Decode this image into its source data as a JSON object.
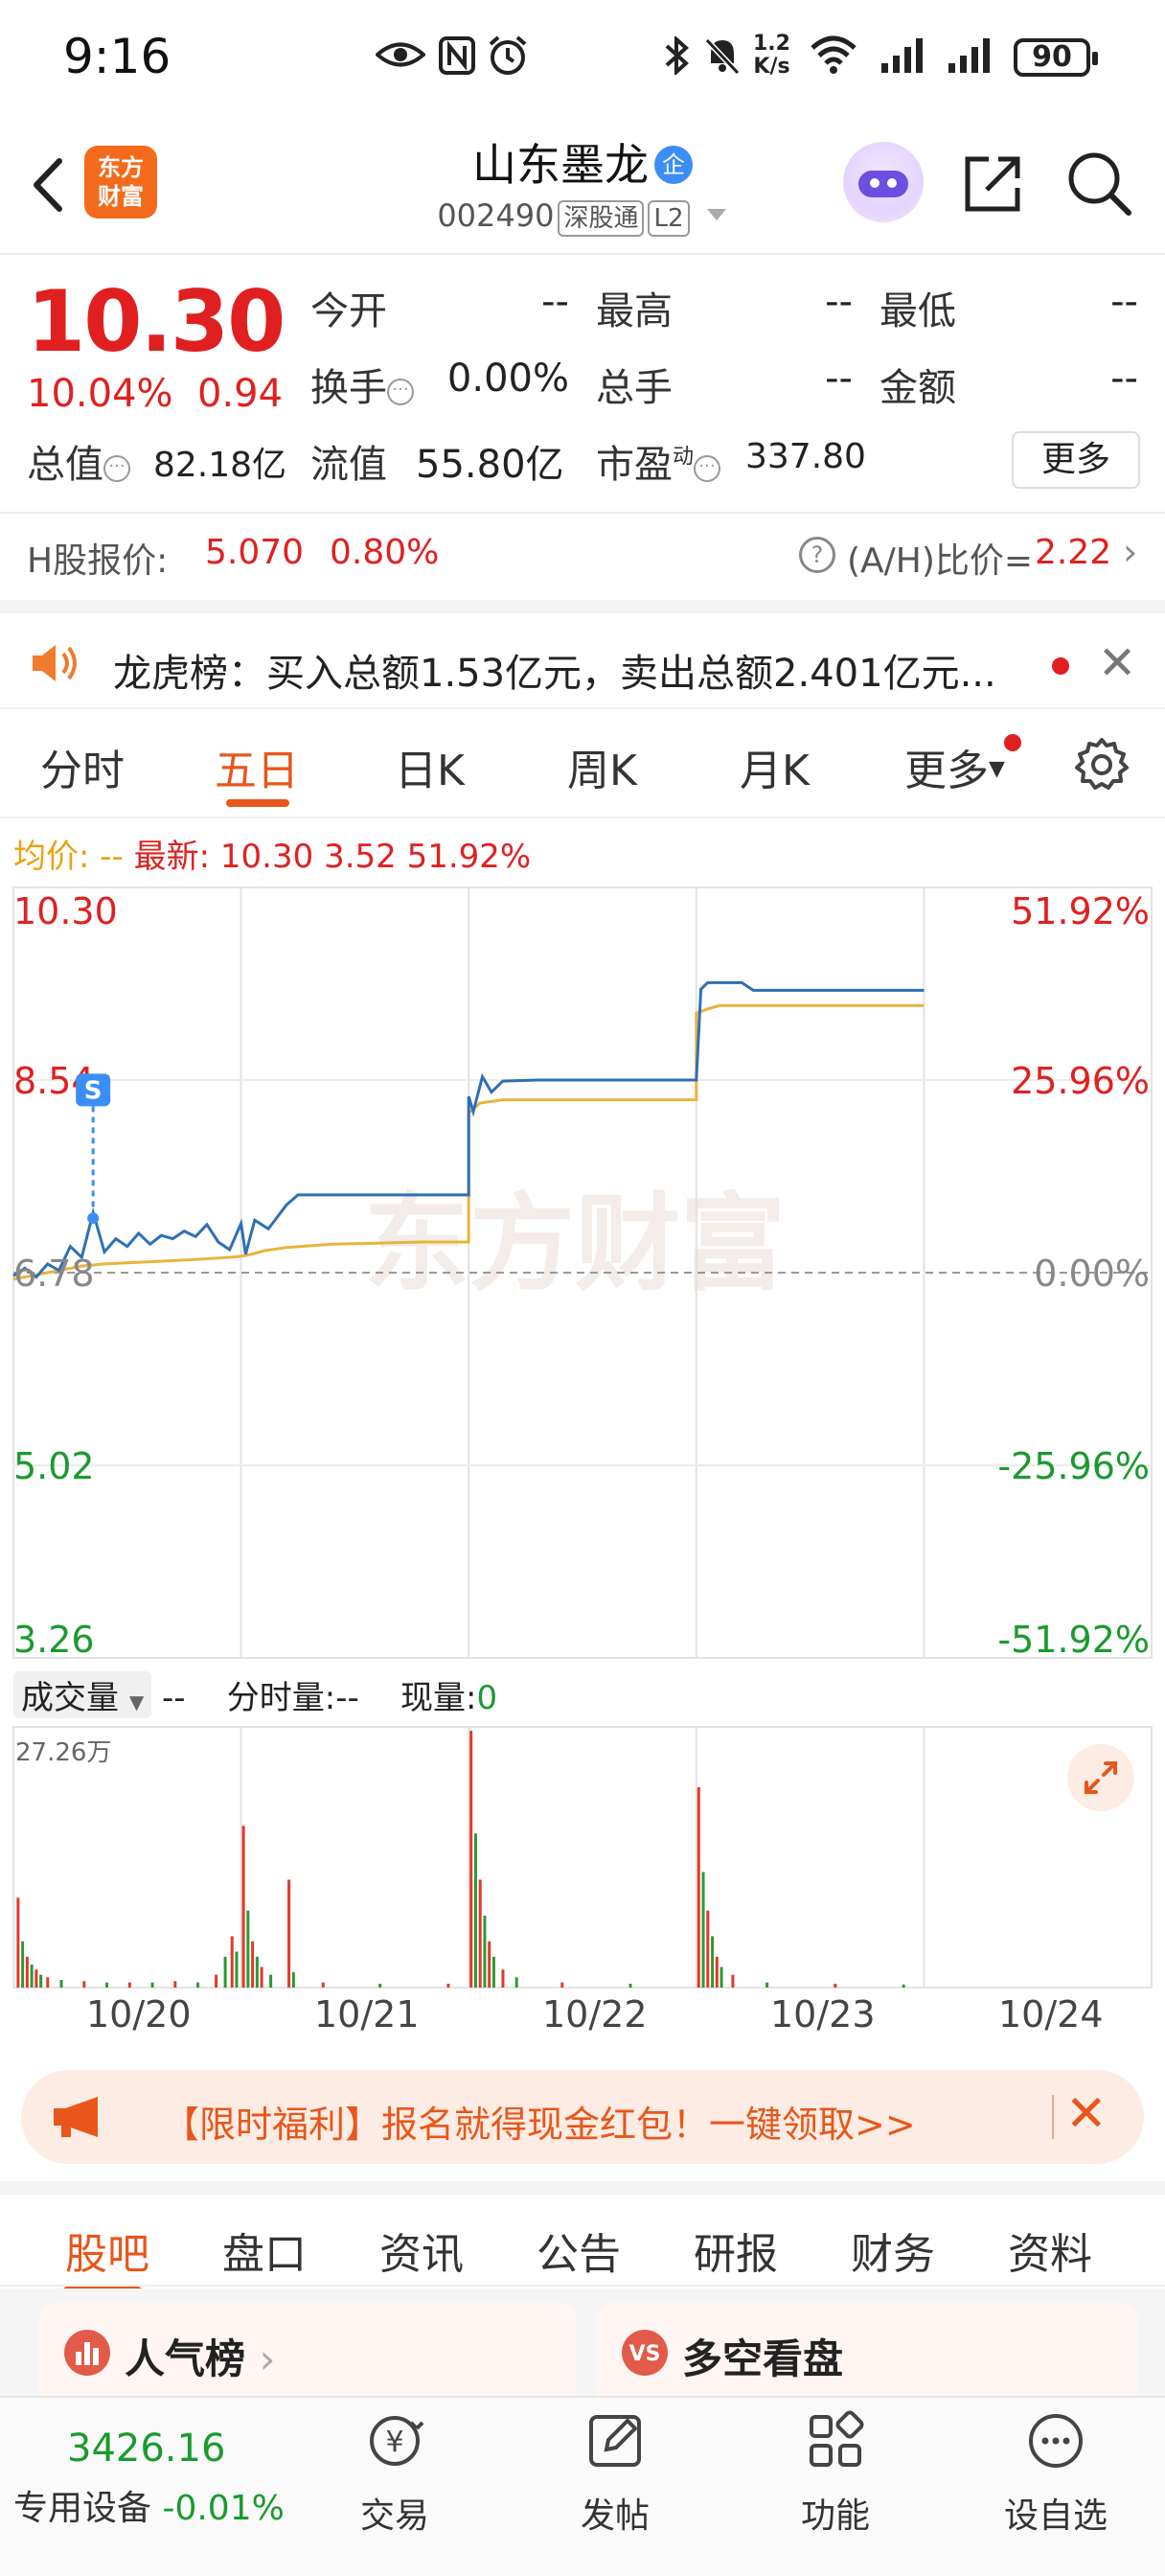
{
  "status_bar": {
    "time": "9:16",
    "net_speed": "1.2\nK/s",
    "battery": "90"
  },
  "header": {
    "app_logo_line1": "东方",
    "app_logo_line2": "财富",
    "stock_name": "山东墨龙",
    "name_badge": "企",
    "stock_code": "002490",
    "tag_connect": "深股通",
    "tag_level": "L2"
  },
  "quote": {
    "price": "10.30",
    "change_pct": "10.04%",
    "change_amt": "0.94",
    "open_label": "今开",
    "open_val": "--",
    "high_label": "最高",
    "high_val": "--",
    "low_label": "最低",
    "low_val": "--",
    "turnover_label": "换手",
    "turnover_val": "0.00%",
    "volume_label": "总手",
    "volume_val": "--",
    "amount_label": "金额",
    "amount_val": "--",
    "mktcap_label": "总值",
    "mktcap_val": "82.18亿",
    "float_label": "流值",
    "float_val": "55.80亿",
    "pe_label": "市盈",
    "pe_sup": "动",
    "pe_val": "337.80",
    "more_label": "更多"
  },
  "h_share": {
    "label": "H股报价:",
    "price": "5.070",
    "pct": "0.80%",
    "ratio_label": "(A/H)比价=",
    "ratio_val": "2.22"
  },
  "notice": {
    "text": "龙虎榜：买入总额1.53亿元，卖出总额2.401亿元..."
  },
  "tabs": [
    "分时",
    "五日",
    "日K",
    "周K",
    "月K",
    "更多"
  ],
  "active_tab": "五日",
  "legend": {
    "avg_label": "均价:",
    "avg_val": "--",
    "latest_label": "最新:",
    "latest_price": "10.30",
    "latest_chg": "3.52",
    "latest_pct": "51.92%"
  },
  "colors": {
    "up": "#e02020",
    "down": "#1a9a2e",
    "accent": "#e8561b",
    "price_line": "#2f6fb5",
    "avg_line": "#e8b43a"
  },
  "chart_data": {
    "type": "line",
    "title": "",
    "x_days": [
      "10/20",
      "10/21",
      "10/22",
      "10/23",
      "10/24"
    ],
    "y_left_ticks": [
      "10.30",
      "8.54",
      "6.78",
      "5.02",
      "3.26"
    ],
    "y_right_ticks": [
      "51.92%",
      "25.96%",
      "0.00%",
      "-25.96%",
      "-51.92%"
    ],
    "ylim": [
      3.26,
      10.3
    ],
    "prev_close": 6.78,
    "watermark": "东方财富",
    "signal_marker": "S",
    "series": [
      {
        "name": "price",
        "values": [
          6.75,
          6.82,
          6.74,
          6.86,
          6.8,
          7.02,
          6.92,
          7.33,
          6.97,
          7.09,
          7.02,
          7.14,
          7.04,
          7.12,
          7.09,
          7.16,
          7.11,
          7.22,
          7.06,
          6.99,
          7.23,
          6.95,
          7.26,
          7.18,
          7.4,
          7.49,
          7.49,
          8.39,
          8.25,
          8.57,
          8.43,
          8.53,
          8.54,
          8.54,
          9.37,
          9.43,
          9.43,
          9.36,
          9.36
        ],
        "x": [
          0.0,
          0.05,
          0.1,
          0.15,
          0.2,
          0.25,
          0.3,
          0.35,
          0.4,
          0.45,
          0.5,
          0.55,
          0.6,
          0.65,
          0.7,
          0.75,
          0.8,
          0.85,
          0.9,
          0.95,
          1.0,
          1.02,
          1.06,
          1.12,
          1.2,
          1.25,
          2.0,
          2.0,
          2.02,
          2.06,
          2.1,
          2.15,
          2.3,
          3.0,
          3.02,
          3.05,
          3.2,
          3.25,
          4.0
        ]
      },
      {
        "name": "avg",
        "values": [
          6.72,
          6.76,
          6.8,
          6.84,
          6.86,
          6.88,
          6.9,
          6.92,
          6.93,
          6.95,
          6.98,
          7.01,
          7.04,
          7.06,
          7.06,
          8.24,
          8.33,
          8.36,
          8.36,
          9.15,
          9.19,
          9.22,
          9.22
        ],
        "x": [
          0.0,
          0.1,
          0.2,
          0.3,
          0.4,
          0.6,
          0.8,
          0.95,
          1.0,
          1.05,
          1.1,
          1.2,
          1.4,
          1.8,
          2.0,
          2.0,
          2.05,
          2.15,
          3.0,
          3.0,
          3.05,
          3.1,
          4.0
        ]
      }
    ]
  },
  "volume": {
    "selector_label": "成交量",
    "selector_val": "--",
    "minute_label": "分时量:",
    "minute_val": "--",
    "current_label": "现量:",
    "current_val": "0",
    "max_label": "27.26万",
    "bars": [
      {
        "x": 0.01,
        "v": 0.35,
        "c": "up"
      },
      {
        "x": 0.03,
        "v": 0.18,
        "c": "down"
      },
      {
        "x": 0.05,
        "v": 0.12,
        "c": "up"
      },
      {
        "x": 0.07,
        "v": 0.09,
        "c": "down"
      },
      {
        "x": 0.09,
        "v": 0.07,
        "c": "up"
      },
      {
        "x": 0.11,
        "v": 0.05,
        "c": "down"
      },
      {
        "x": 0.14,
        "v": 0.04,
        "c": "up"
      },
      {
        "x": 0.2,
        "v": 0.03,
        "c": "down"
      },
      {
        "x": 0.3,
        "v": 0.025,
        "c": "up"
      },
      {
        "x": 0.4,
        "v": 0.02,
        "c": "down"
      },
      {
        "x": 0.5,
        "v": 0.02,
        "c": "up"
      },
      {
        "x": 0.6,
        "v": 0.02,
        "c": "down"
      },
      {
        "x": 0.7,
        "v": 0.025,
        "c": "up"
      },
      {
        "x": 0.8,
        "v": 0.02,
        "c": "down"
      },
      {
        "x": 0.88,
        "v": 0.05,
        "c": "up"
      },
      {
        "x": 0.92,
        "v": 0.12,
        "c": "down"
      },
      {
        "x": 0.95,
        "v": 0.2,
        "c": "up"
      },
      {
        "x": 0.97,
        "v": 0.14,
        "c": "down"
      },
      {
        "x": 1.0,
        "v": 0.63,
        "c": "up"
      },
      {
        "x": 1.02,
        "v": 0.3,
        "c": "down"
      },
      {
        "x": 1.04,
        "v": 0.18,
        "c": "up"
      },
      {
        "x": 1.06,
        "v": 0.12,
        "c": "down"
      },
      {
        "x": 1.08,
        "v": 0.08,
        "c": "up"
      },
      {
        "x": 1.12,
        "v": 0.05,
        "c": "down"
      },
      {
        "x": 1.2,
        "v": 0.42,
        "c": "up"
      },
      {
        "x": 1.22,
        "v": 0.06,
        "c": "down"
      },
      {
        "x": 1.35,
        "v": 0.02,
        "c": "up"
      },
      {
        "x": 1.6,
        "v": 0.015,
        "c": "down"
      },
      {
        "x": 1.9,
        "v": 0.015,
        "c": "up"
      },
      {
        "x": 2.0,
        "v": 1.0,
        "c": "up"
      },
      {
        "x": 2.02,
        "v": 0.6,
        "c": "down"
      },
      {
        "x": 2.04,
        "v": 0.42,
        "c": "up"
      },
      {
        "x": 2.06,
        "v": 0.28,
        "c": "down"
      },
      {
        "x": 2.08,
        "v": 0.18,
        "c": "up"
      },
      {
        "x": 2.1,
        "v": 0.12,
        "c": "down"
      },
      {
        "x": 2.14,
        "v": 0.07,
        "c": "up"
      },
      {
        "x": 2.2,
        "v": 0.04,
        "c": "down"
      },
      {
        "x": 2.4,
        "v": 0.02,
        "c": "up"
      },
      {
        "x": 2.7,
        "v": 0.015,
        "c": "down"
      },
      {
        "x": 3.0,
        "v": 0.78,
        "c": "up"
      },
      {
        "x": 3.02,
        "v": 0.45,
        "c": "down"
      },
      {
        "x": 3.04,
        "v": 0.3,
        "c": "up"
      },
      {
        "x": 3.06,
        "v": 0.2,
        "c": "down"
      },
      {
        "x": 3.08,
        "v": 0.12,
        "c": "up"
      },
      {
        "x": 3.1,
        "v": 0.08,
        "c": "down"
      },
      {
        "x": 3.15,
        "v": 0.05,
        "c": "up"
      },
      {
        "x": 3.3,
        "v": 0.02,
        "c": "down"
      },
      {
        "x": 3.6,
        "v": 0.015,
        "c": "up"
      },
      {
        "x": 3.9,
        "v": 0.012,
        "c": "down"
      }
    ]
  },
  "promo": {
    "text": "【限时福利】报名就得现金红包！一键领取>>"
  },
  "bottom_tabs": [
    "股吧",
    "盘口",
    "资讯",
    "公告",
    "研报",
    "财务",
    "资料"
  ],
  "active_bottom_tab": "股吧",
  "cards": {
    "popular": "人气榜",
    "longshort": "多空看盘",
    "vs_badge": "VS"
  },
  "bottom_nav": {
    "index_val": "3426.16",
    "index_label": "专用设备",
    "index_pct": "-0.01%",
    "items": [
      "交易",
      "发帖",
      "功能",
      "设自选"
    ]
  }
}
